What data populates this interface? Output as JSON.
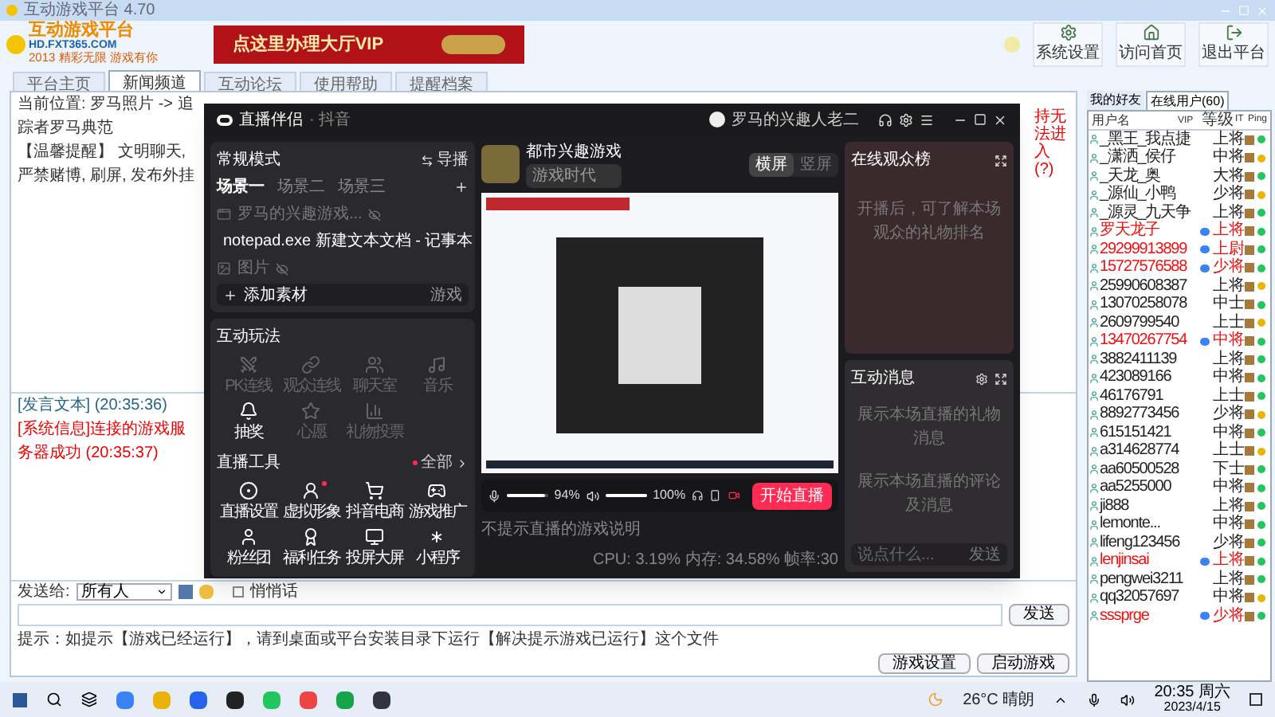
{
  "window": {
    "title": "互动游戏平台 4.70"
  },
  "header": {
    "logo_title": "互动游戏平台",
    "logo_url": "HD.FXT365.COM",
    "logo_slogan": "2013 精彩无限 游戏有你",
    "banner": "点这里办理大厅VIP",
    "tools": [
      "系统设置",
      "访问首页",
      "退出平台"
    ]
  },
  "nav_tabs": [
    {
      "label": "平台主页",
      "selected": false
    },
    {
      "label": "新闻频道",
      "selected": true
    },
    {
      "label": "互动论坛",
      "selected": false
    },
    {
      "label": "使用帮助",
      "selected": false
    },
    {
      "label": "提醒档案",
      "selected": false
    }
  ],
  "breadcrumb": "当前位置: 罗马照片 -> 追踪者罗马典范",
  "notice": "【温馨提醒】 文明聊天, 严禁赌博, 刷屏, 发布外挂",
  "side_notice": "持无法进入(?)",
  "chat": [
    {
      "kind": "self",
      "text": "[发言文本] (20:35:36)"
    },
    {
      "kind": "system",
      "text": "[系统信息]连接的游戏服务器成功 (20:35:37)"
    }
  ],
  "send": {
    "label": "发送给:",
    "target": "所有人",
    "whisper": {
      "label": "悄悄话",
      "checked": false
    },
    "button": "发送"
  },
  "hint": "提示：如提示【游戏已经运行】，请到桌面或平台安装目录下运行【解决提示游戏已运行】这个文件",
  "bottom_buttons": [
    "游戏设置",
    "启动游戏"
  ],
  "user_panel": {
    "tabs": [
      {
        "label": "我的好友",
        "selected": false
      },
      {
        "label": "在线用户(60)",
        "selected": true
      }
    ],
    "columns": [
      "用户名",
      "VIP",
      "等级",
      "IT",
      "Ping"
    ],
    "rows": [
      {
        "name": "_黑王_我点捷",
        "vip": false,
        "rank": "上将",
        "color": "#22c55e"
      },
      {
        "name": "_潇洒_侯仔",
        "vip": false,
        "rank": "中将",
        "color": "#eab308"
      },
      {
        "name": "_天龙_奥",
        "vip": false,
        "rank": "大将",
        "color": "#22c55e"
      },
      {
        "name": "_源仙_小鸭",
        "vip": false,
        "rank": "少将",
        "color": "#eab308"
      },
      {
        "name": "_源灵_九天争",
        "vip": false,
        "rank": "上将",
        "color": "#22c55e"
      },
      {
        "name": "罗天龙子",
        "vip": true,
        "rank": "上将",
        "color": "#22c55e"
      },
      {
        "name": "29299913899",
        "vip": true,
        "rank": "上尉",
        "color": "#22c55e"
      },
      {
        "name": "15727576588",
        "vip": true,
        "rank": "少将",
        "color": "#22c55e"
      },
      {
        "name": "25990608387",
        "vip": false,
        "rank": "上将",
        "color": "#eab308"
      },
      {
        "name": "13070258078",
        "vip": false,
        "rank": "中士",
        "color": "#22c55e"
      },
      {
        "name": "2609799540",
        "vip": false,
        "rank": "上士",
        "color": "#eab308"
      },
      {
        "name": "13470267754",
        "vip": true,
        "rank": "中将",
        "color": "#22c55e"
      },
      {
        "name": "3882411139",
        "vip": false,
        "rank": "上将",
        "color": "#22c55e"
      },
      {
        "name": "423089166",
        "vip": false,
        "rank": "中将",
        "color": "#22c55e"
      },
      {
        "name": "46176791",
        "vip": false,
        "rank": "上士",
        "color": "#22c55e"
      },
      {
        "name": "8892773456",
        "vip": false,
        "rank": "少将",
        "color": "#eab308"
      },
      {
        "name": "615151421",
        "vip": false,
        "rank": "中将",
        "color": "#22c55e"
      },
      {
        "name": "a314628774",
        "vip": false,
        "rank": "上士",
        "color": "#eab308"
      },
      {
        "name": "aa60500528",
        "vip": false,
        "rank": "下士",
        "color": "#22c55e"
      },
      {
        "name": "aa5255000",
        "vip": false,
        "rank": "中将",
        "color": "#22c55e"
      },
      {
        "name": "ji888",
        "vip": false,
        "rank": "上将",
        "color": "#22c55e"
      },
      {
        "name": "lemonte...",
        "vip": false,
        "rank": "中将",
        "color": "#22c55e"
      },
      {
        "name": "lifeng123456",
        "vip": false,
        "rank": "少将",
        "color": "#22c55e"
      },
      {
        "name": "lenjinsai",
        "vip": true,
        "rank": "上将",
        "color": "#22c55e"
      },
      {
        "name": "pengwei3211",
        "vip": false,
        "rank": "上将",
        "color": "#22c55e"
      },
      {
        "name": "qq32057697",
        "vip": false,
        "rank": "中将",
        "color": "#eab308"
      },
      {
        "name": "sssprge",
        "vip": true,
        "rank": "少将",
        "color": "#22c55e"
      }
    ]
  },
  "live_app": {
    "title": "直播伴侣",
    "platform": "· 抖音",
    "user": "罗马的兴趣人老二",
    "mode": "常规模式",
    "director": "导播",
    "scenes": [
      {
        "label": "场景一",
        "selected": true
      },
      {
        "label": "场景二",
        "selected": false
      },
      {
        "label": "场景三",
        "selected": false
      }
    ],
    "sources": [
      {
        "kind": "window",
        "label": "罗马的兴趣游戏... ",
        "hidden": true
      },
      {
        "kind": "window",
        "label": "notepad.exe 新建文本文档 - 记事本",
        "hidden": false
      },
      {
        "kind": "image",
        "label": "图片",
        "hidden": true
      }
    ],
    "add_source": "添加素材",
    "add_game": "游戏",
    "plays_title": "互动玩法",
    "plays": [
      {
        "label": "PK连线",
        "disabled": true
      },
      {
        "label": "观众连线",
        "disabled": true
      },
      {
        "label": "聊天室",
        "disabled": true
      },
      {
        "label": "音乐",
        "disabled": true
      },
      {
        "label": "抽奖",
        "disabled": false
      },
      {
        "label": "心愿",
        "disabled": true
      },
      {
        "label": "礼物投票",
        "disabled": true
      }
    ],
    "tools_title": "直播工具",
    "tools_all": "全部",
    "tools": [
      {
        "label": "直播设置",
        "dot": false
      },
      {
        "label": "虚拟形象",
        "dot": true
      },
      {
        "label": "抖音电商",
        "dot": false
      },
      {
        "label": "游戏推广",
        "dot": false
      },
      {
        "label": "粉丝团",
        "dot": false
      },
      {
        "label": "福利任务",
        "dot": false
      },
      {
        "label": "投屏大屏",
        "dot": false
      },
      {
        "label": "小程序",
        "dot": false
      }
    ],
    "stream_title": "都市兴趣游戏",
    "stream_tag": "游戏时代",
    "orientation": [
      {
        "label": "横屏",
        "selected": true
      },
      {
        "label": "竖屏",
        "selected": false
      }
    ],
    "mic": {
      "level": 0.94,
      "reading": "94%"
    },
    "speaker": {
      "level": 1,
      "reading": "100%"
    },
    "start_button": "开始直播",
    "footer_hint": "不提示直播的游戏说明",
    "stats": "CPU: 3.19%  内存: 34.58%  帧率:30",
    "audience_title": "在线观众榜",
    "audience_empty": "开播后，可了解本场观众的礼物排名",
    "messages_title": "互动消息",
    "gift_empty": "展示本场直播的礼物消息",
    "comment_empty": "展示本场直播的评论及消息",
    "message_placeholder": "说点什么...",
    "message_send": "发送"
  },
  "taskbar": {
    "weather": "26°C 晴朗",
    "time": "20:35 周六",
    "date": "2023/4/15"
  }
}
